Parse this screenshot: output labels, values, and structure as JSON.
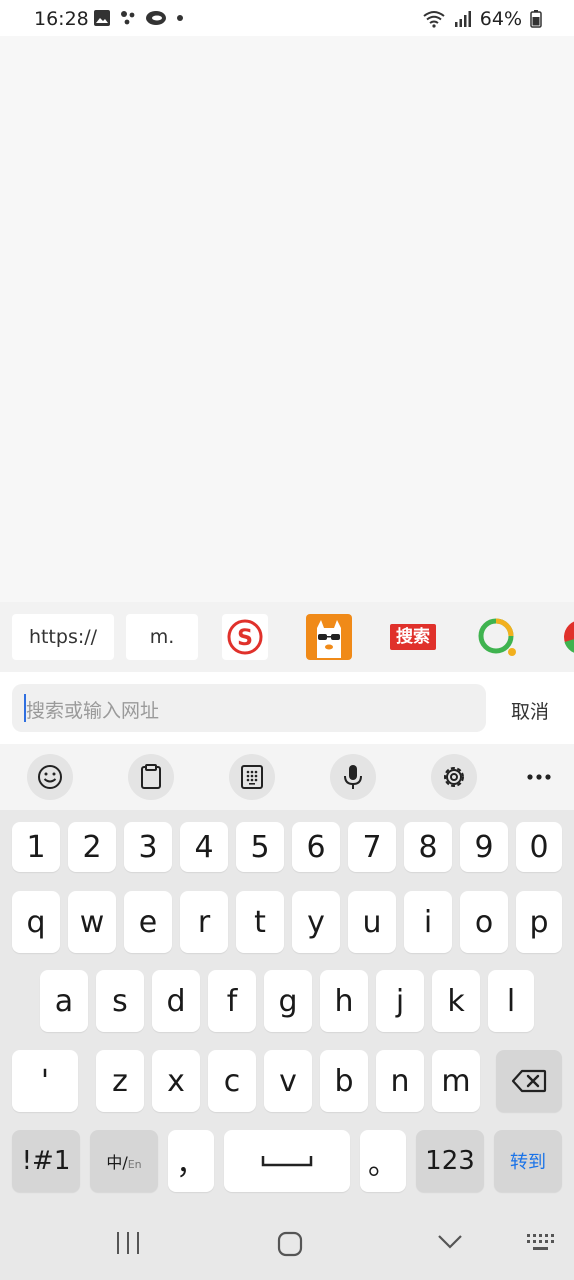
{
  "status_bar": {
    "time": "16:28",
    "battery": "64%",
    "notification_icons": [
      "image-icon",
      "dots-app-icon",
      "cloud-app-icon",
      "dot-icon"
    ],
    "right_icons": [
      "wifi-icon",
      "signal-icon",
      "battery-icon"
    ]
  },
  "quick_input": {
    "chips": [
      "https://",
      "m."
    ],
    "shortcuts": [
      "sogou-icon",
      "uc-llama-icon",
      "search-shortcut-icon",
      "360-icon",
      "chrome-icon"
    ],
    "search_shortcut_label": "搜索"
  },
  "search": {
    "placeholder": "搜索或输入网址",
    "cancel_label": "取消"
  },
  "keyboard_toolbar": {
    "buttons": [
      "emoji-icon",
      "clipboard-icon",
      "keypad-icon",
      "microphone-icon",
      "settings-icon",
      "more-icon"
    ]
  },
  "keyboard": {
    "row_numbers": [
      "1",
      "2",
      "3",
      "4",
      "5",
      "6",
      "7",
      "8",
      "9",
      "0"
    ],
    "row_1": [
      "q",
      "w",
      "e",
      "r",
      "t",
      "y",
      "u",
      "i",
      "o",
      "p"
    ],
    "row_2": [
      "a",
      "s",
      "d",
      "f",
      "g",
      "h",
      "j",
      "k",
      "l"
    ],
    "row_3": [
      "'",
      "z",
      "x",
      "c",
      "v",
      "b",
      "n",
      "m"
    ],
    "symbols_label": "!#1",
    "lang_label_main": "中/",
    "lang_label_sub": "En",
    "comma": "，",
    "period": "。",
    "numbers_label": "123",
    "go_label": "转到"
  },
  "colors": {
    "accent": "#1a73e8",
    "caret": "#2f6fe0",
    "key_bg": "#ffffff",
    "key_dark_bg": "#d6d6d6",
    "keyboard_bg": "#e8e8e8"
  }
}
